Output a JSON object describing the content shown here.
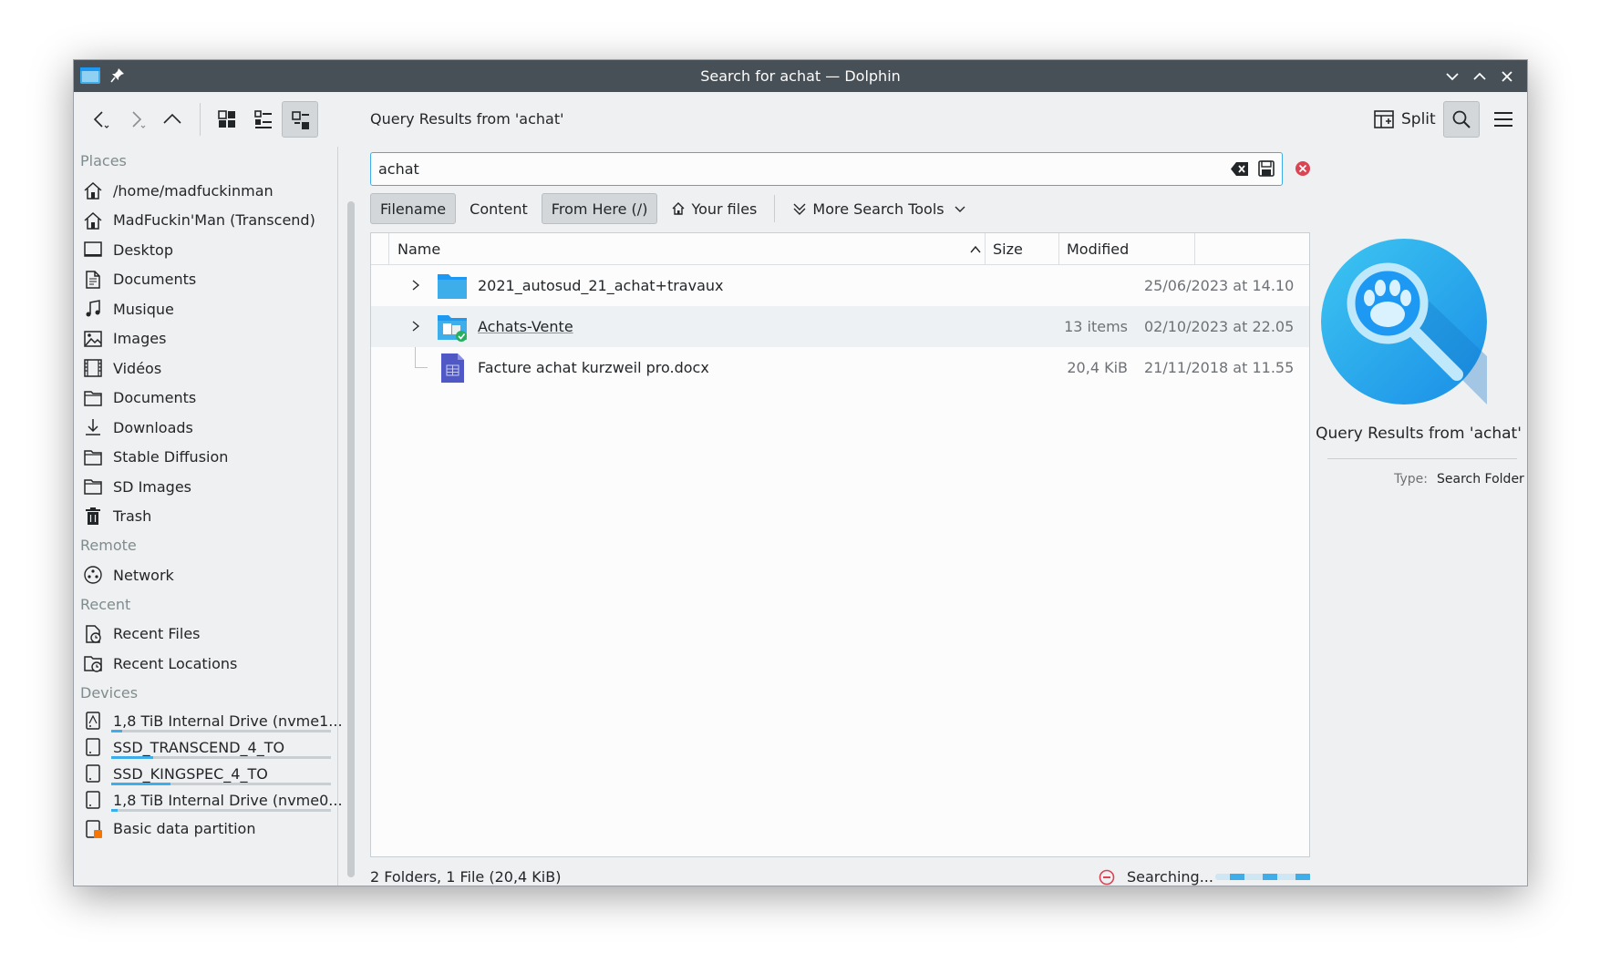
{
  "window": {
    "title": "Search for achat — Dolphin"
  },
  "toolbar": {
    "location_title": "Query Results from 'achat'",
    "split_label": "Split"
  },
  "places": {
    "sections": {
      "places": "Places",
      "remote": "Remote",
      "recent": "Recent",
      "devices": "Devices"
    },
    "places_items": [
      {
        "label": "/home/madfuckinman",
        "icon": "home-icon"
      },
      {
        "label": "MadFuckin'Man (Transcend)",
        "icon": "home-icon"
      },
      {
        "label": "Desktop",
        "icon": "desktop-icon"
      },
      {
        "label": "Documents",
        "icon": "document-icon"
      },
      {
        "label": "Musique",
        "icon": "music-icon"
      },
      {
        "label": "Images",
        "icon": "image-icon"
      },
      {
        "label": "Vidéos",
        "icon": "video-icon"
      },
      {
        "label": "Documents",
        "icon": "folder-icon"
      },
      {
        "label": "Downloads",
        "icon": "download-icon"
      },
      {
        "label": "Stable Diffusion",
        "icon": "folder-icon"
      },
      {
        "label": "SD Images",
        "icon": "folder-icon"
      },
      {
        "label": "Trash",
        "icon": "trash-icon"
      }
    ],
    "remote_items": [
      {
        "label": "Network",
        "icon": "network-icon"
      }
    ],
    "recent_items": [
      {
        "label": "Recent Files",
        "icon": "recent-files-icon"
      },
      {
        "label": "Recent Locations",
        "icon": "recent-locations-icon"
      }
    ],
    "device_items": [
      {
        "label": "1,8 TiB Internal Drive (nvme1...",
        "usage": 0.05
      },
      {
        "label": "SSD_TRANSCEND_4_TO",
        "usage": 0.19
      },
      {
        "label": "SSD_KINGSPEC_4_TO",
        "usage": 0.27
      },
      {
        "label": "1,8 TiB Internal Drive (nvme0...",
        "usage": 0.03
      },
      {
        "label": "Basic data partition",
        "usage": null
      }
    ]
  },
  "search": {
    "query": "achat",
    "filters": {
      "filename": "Filename",
      "content": "Content",
      "from_here": "From Here (/)",
      "your_files": "Your files",
      "more_tools": "More Search Tools"
    }
  },
  "columns": {
    "name": "Name",
    "size": "Size",
    "modified": "Modified"
  },
  "files": [
    {
      "name": "2021_autosud_21_achat+travaux",
      "size": "",
      "modified": "25/06/2023 at 14.10",
      "type": "folder"
    },
    {
      "name": "Achats-Vente",
      "size": "13 items",
      "modified": "02/10/2023 at 22.05",
      "type": "shared-folder"
    },
    {
      "name": "Facture achat kurzweil pro.docx",
      "size": "20,4 KiB",
      "modified": "21/11/2018 at 11.55",
      "type": "document"
    }
  ],
  "status": {
    "summary": "2 Folders, 1 File (20,4 KiB)",
    "searching": "Searching..."
  },
  "info_panel": {
    "title": "Query Results from 'achat'",
    "type_key": "Type:",
    "type_value": "Search Folder"
  },
  "colors": {
    "accent": "#3daee9",
    "titlebar": "#475057",
    "close_red": "#da4453"
  }
}
